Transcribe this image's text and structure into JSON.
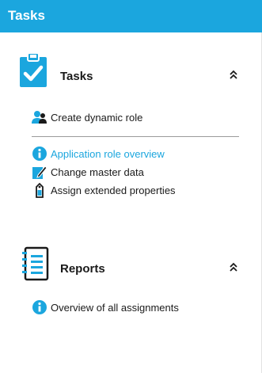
{
  "header": {
    "title": "Tasks"
  },
  "sections": [
    {
      "title": "Tasks",
      "icon": "clipboard-check-icon",
      "collapse_icon": "double-chevron-up-icon",
      "items": [
        {
          "label": "Create dynamic role",
          "icon": "users-icon"
        },
        {
          "label": "Application role overview",
          "icon": "info-icon",
          "active": true
        },
        {
          "label": "Change master data",
          "icon": "edit-pencil-icon"
        },
        {
          "label": "Assign extended properties",
          "icon": "tag-icon"
        }
      ]
    },
    {
      "title": "Reports",
      "icon": "report-list-icon",
      "collapse_icon": "double-chevron-up-icon",
      "items": [
        {
          "label": "Overview of all assignments",
          "icon": "info-icon"
        }
      ]
    }
  ],
  "colors": {
    "accent": "#1ba6de",
    "text": "#1a1a1a",
    "header_bg": "#1ba6de"
  }
}
